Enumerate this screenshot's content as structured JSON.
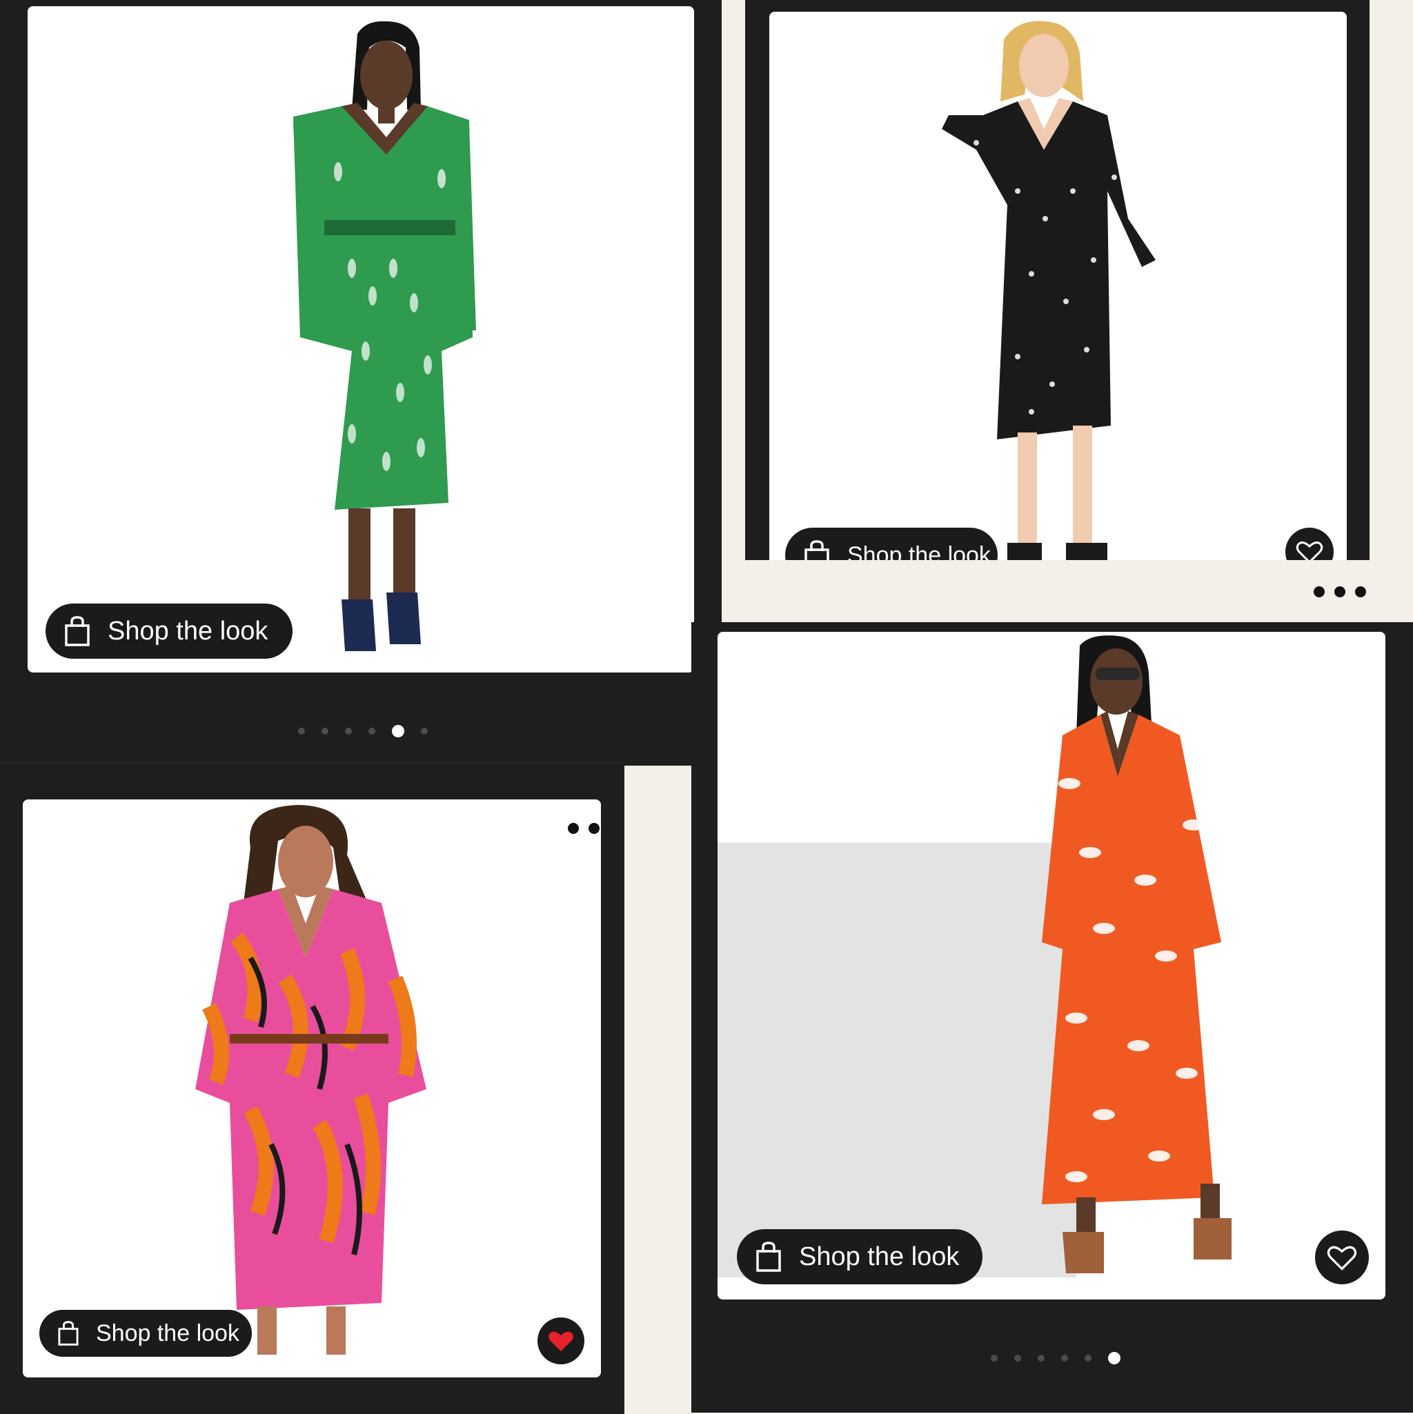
{
  "cards": [
    {
      "id": "green-wrap-dress",
      "shop_label": "Shop the look",
      "favorite": null,
      "image": "green geometric print long-sleeve wrap dress"
    },
    {
      "id": "black-print-wrap-dress",
      "shop_label": "Shop the look",
      "favorite": "unfilled",
      "image": "black and white print long-sleeve wrap dress"
    },
    {
      "id": "zebra-robe",
      "shop_label": "Shop the look",
      "favorite": "filled",
      "image": "pink and orange zebra print robe"
    },
    {
      "id": "orange-maxi-dress",
      "shop_label": "Shop the look",
      "favorite": "unfilled",
      "image": "orange and white print maxi dress"
    }
  ],
  "carousels": {
    "top_left": {
      "count": 6,
      "active_index": 4
    },
    "bottom_right": {
      "count": 6,
      "active_index": 5
    }
  },
  "icons": {
    "shop": "shopping-bag-icon",
    "favorite_empty": "heart-outline-icon",
    "favorite_filled": "heart-filled-icon",
    "more": "more-options-icon"
  },
  "colors": {
    "background": "#f4efe9",
    "panel": "#1e1e1e",
    "button": "#1b1b1b",
    "heart_filled": "#e8222c"
  }
}
